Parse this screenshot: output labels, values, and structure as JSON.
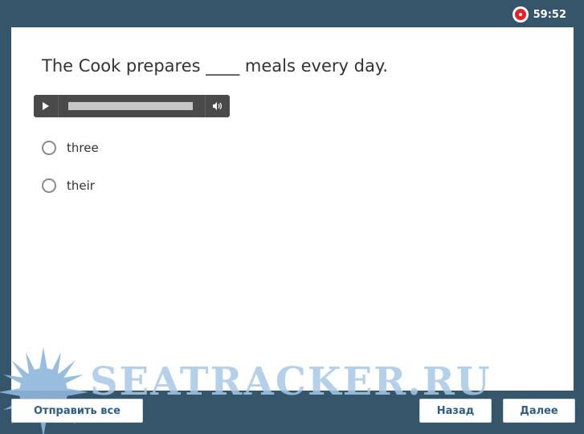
{
  "timer": {
    "remaining": "59:52",
    "record_icon": "record-icon"
  },
  "question": {
    "text": "The Cook prepares ____ meals every day."
  },
  "audio_player": {
    "play_icon": "play-icon",
    "volume_icon": "volume-icon"
  },
  "options": [
    {
      "label": "three"
    },
    {
      "label": "their"
    }
  ],
  "footer": {
    "submit_all_label": "Отправить все",
    "back_label": "Назад",
    "next_label": "Далее"
  },
  "watermark": {
    "text": "SEATRACKER.RU",
    "logo_icon": "sun-logo-icon"
  },
  "colors": {
    "background": "#35556b",
    "card": "#ffffff",
    "record": "#e5222a",
    "button_text": "#2f5e85",
    "watermark": "#a8c9e6"
  }
}
